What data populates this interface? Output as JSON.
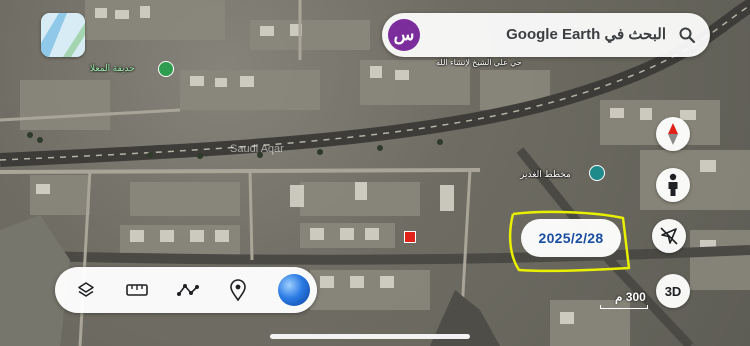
{
  "search": {
    "avatar_letter": "س",
    "text": "البحث في Google Earth",
    "icon": "search-icon"
  },
  "map": {
    "poi_labels": [
      {
        "text": "حديقة المعلا"
      },
      {
        "text": "مخطط الغدير"
      },
      {
        "text": "حي علي الشيخ لإنشاء الله"
      },
      {
        "text": "Saudi Aqar"
      }
    ]
  },
  "controls": {
    "compass_icon": "compass-icon",
    "street_view_icon": "pegman-icon",
    "location_off_icon": "location-off-icon",
    "three_d_label": "3D"
  },
  "date_chip": {
    "value": "2025/2/28",
    "annotation_color": "#e8f000"
  },
  "toolbar": {
    "items": [
      "layers-icon",
      "ruler-icon",
      "path-icon",
      "pin-icon",
      "globe-icon"
    ]
  },
  "scale": {
    "label": "300 م"
  },
  "colors": {
    "avatar": "#7b2d9c",
    "date_text": "#1a4ea0",
    "poi_green": "#2e9d4f",
    "poi_teal": "#1e8a8a",
    "marker_red": "#e0221b"
  }
}
